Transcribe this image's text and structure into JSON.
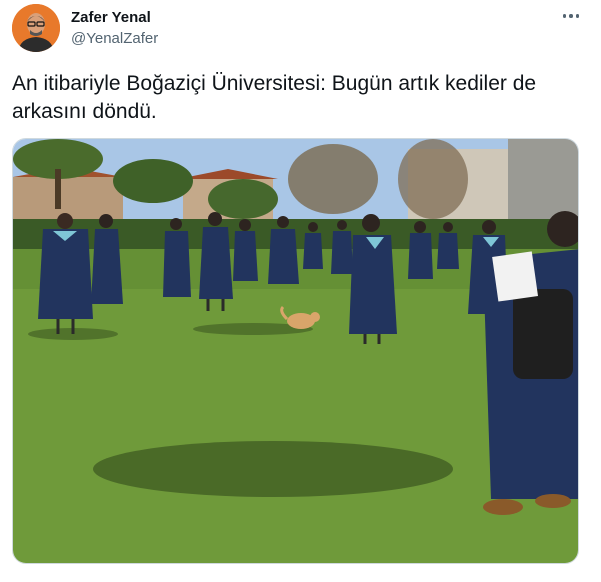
{
  "author": {
    "name": "Zafer Yenal",
    "handle": "@YenalZafer",
    "avatar_color": "#e8792b"
  },
  "tweet": {
    "text": "An itibariyle Boğaziçi Üniversitesi: Bugün artık kediler de arkasını döndü."
  },
  "icons": {
    "more": "more-options-icon"
  },
  "colors": {
    "text": "#0f1419",
    "secondary": "#536471",
    "grass": "#6f9a3a",
    "gown": "#22345e"
  }
}
